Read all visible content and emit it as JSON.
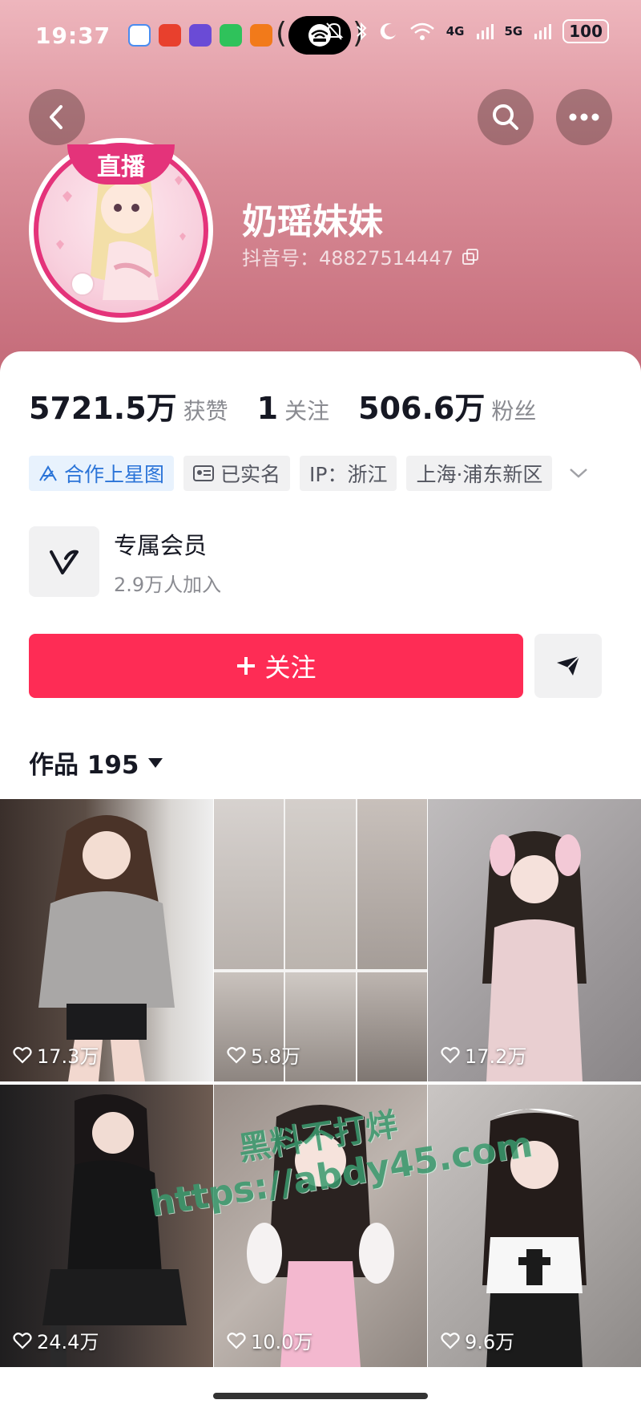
{
  "status_bar": {
    "time": "19:37",
    "battery": "100",
    "sig1": "4G",
    "sig2": "5G"
  },
  "header": {
    "back_icon": "back-arrow-icon",
    "search_icon": "search-icon",
    "more_icon": "more-dots-icon"
  },
  "profile": {
    "live_badge": "直播",
    "name": "奶瑶妹妹",
    "douyin_id": "抖音号：48827514447"
  },
  "stats": [
    {
      "num": "5721.5万",
      "label": "获赞"
    },
    {
      "num": "1",
      "label": "关注"
    },
    {
      "num": "506.6万",
      "label": "粉丝"
    }
  ],
  "tags": [
    {
      "label": "合作上星图"
    },
    {
      "label": "已实名"
    },
    {
      "label": "IP：浙江"
    },
    {
      "label": "上海·浦东新区"
    }
  ],
  "member": {
    "title": "专属会员",
    "subtitle": "2.9万人加入"
  },
  "actions": {
    "follow_label": "关注"
  },
  "works": {
    "label": "作品 195"
  },
  "videos": [
    {
      "likes": "17.3万"
    },
    {
      "likes": "5.8万"
    },
    {
      "likes": "17.2万"
    },
    {
      "likes": "24.4万"
    },
    {
      "likes": "10.0万"
    },
    {
      "likes": "9.6万"
    }
  ],
  "watermark": {
    "line1": "黑料不打烊",
    "line2": "https://abdy45.com"
  },
  "colors": {
    "accent": "#fe2c55",
    "live": "#e4337a"
  }
}
